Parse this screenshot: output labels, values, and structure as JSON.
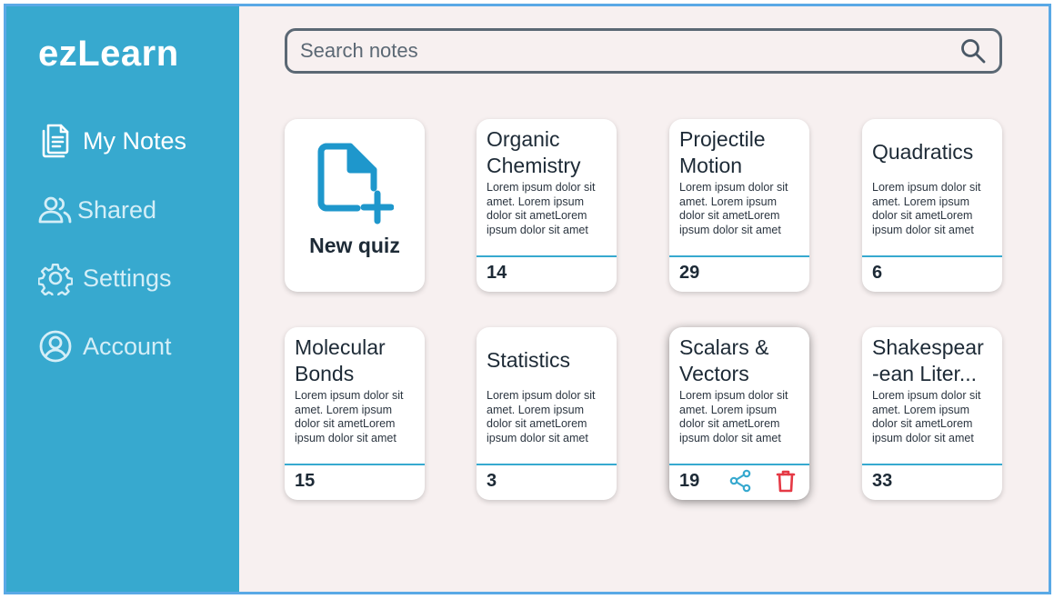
{
  "app": {
    "logo": "ezLearn"
  },
  "sidebar": {
    "items": [
      {
        "label": "My Notes",
        "icon": "notes-icon",
        "active": true
      },
      {
        "label": "Shared",
        "icon": "users-icon",
        "active": false
      },
      {
        "label": "Settings",
        "icon": "gear-icon",
        "active": false
      },
      {
        "label": "Account",
        "icon": "account-icon",
        "active": false
      }
    ]
  },
  "search": {
    "placeholder": "Search notes",
    "value": ""
  },
  "new_quiz": {
    "label": "New quiz",
    "icon": "new-file-icon"
  },
  "notes": [
    {
      "title": "Organic\nChemistry",
      "desc": "Lorem ipsum dolor sit amet. Lorem ipsum dolor sit ametLorem ipsum dolor sit amet",
      "count": "14"
    },
    {
      "title": "Projectile\nMotion",
      "desc": "Lorem ipsum dolor sit amet. Lorem ipsum dolor sit ametLorem ipsum dolor sit amet",
      "count": "29"
    },
    {
      "title": "Quadratics",
      "desc": "Lorem ipsum dolor sit amet. Lorem ipsum dolor sit ametLorem ipsum dolor sit amet",
      "count": "6"
    },
    {
      "title": "Molecular\nBonds",
      "desc": "Lorem ipsum dolor sit amet. Lorem ipsum dolor sit ametLorem ipsum dolor sit amet",
      "count": "15"
    },
    {
      "title": "Statistics",
      "desc": "Lorem ipsum dolor sit amet. Lorem ipsum dolor sit ametLorem ipsum dolor sit amet",
      "count": "3"
    },
    {
      "title": "Scalars &\nVectors",
      "desc": "Lorem ipsum dolor sit amet. Lorem ipsum dolor sit ametLorem ipsum dolor sit amet",
      "count": "19",
      "selected": true
    },
    {
      "title": "Shakespear\n-ean Liter...",
      "desc": "Lorem ipsum dolor sit amet. Lorem ipsum dolor sit ametLorem ipsum dolor sit amet",
      "count": "33"
    }
  ],
  "colors": {
    "sidebar": "#37a9cf",
    "accent": "#37a9cf",
    "delete": "#e53945",
    "background": "#f7f0f0"
  }
}
